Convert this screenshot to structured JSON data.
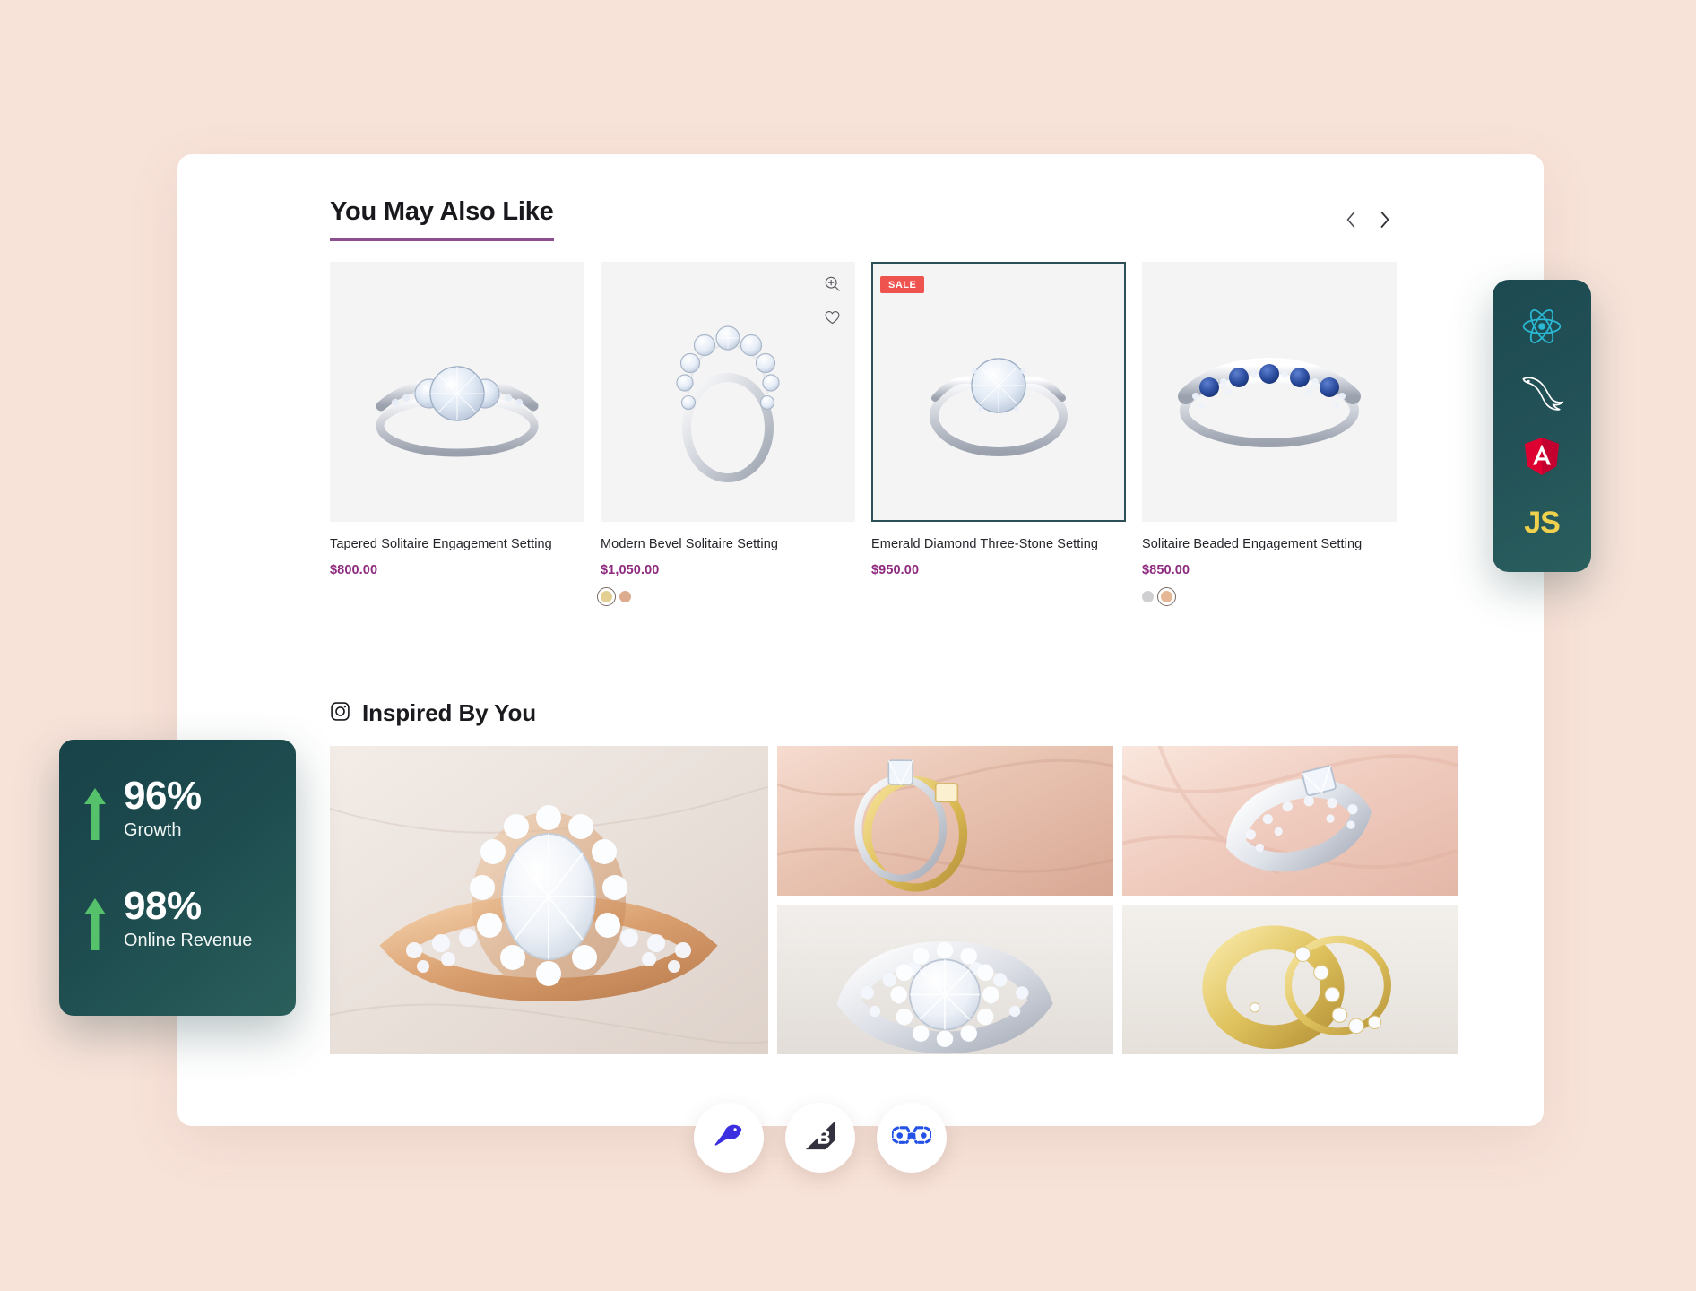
{
  "theme": {
    "page_background": "#f8e3d9",
    "panel_background": "#ffffff",
    "accent_underline": "#8e4f91",
    "price_color": "#8e2b7f",
    "sale_badge_color": "#ef5350",
    "selected_card_border": "#2c4f58",
    "stats_card_gradient_from": "#184349",
    "stats_card_gradient_to": "#2a5f5c",
    "arrow_green": "#55c16a",
    "js_yellow": "#f0d14e",
    "angular_red": "#dd0031",
    "react_cyan": "#2bb8d4"
  },
  "recommendations": {
    "title": "You May Also Like",
    "nav": {
      "prev_icon": "chevron-left-icon",
      "prev_label": "Previous",
      "next_icon": "chevron-right-icon",
      "next_label": "Next"
    },
    "products": [
      {
        "name": "Tapered Solitaire Engagement Setting",
        "price": "$800.00",
        "badge": "",
        "selected": false,
        "show_tools": false,
        "swatches": []
      },
      {
        "name": "Modern Bevel Solitaire Setting",
        "price": "$1,050.00",
        "badge": "",
        "selected": false,
        "show_tools": true,
        "tools": [
          {
            "icon": "zoom-in-icon",
            "label": "Quick view"
          },
          {
            "icon": "heart-icon",
            "label": "Add to wishlist"
          }
        ],
        "swatches": [
          {
            "name": "yellow-gold",
            "color": "#e3cf92",
            "active": true
          },
          {
            "name": "rose-gold",
            "color": "#ddab8e",
            "active": false
          }
        ]
      },
      {
        "name": "Emerald Diamond Three-Stone Setting",
        "price": "$950.00",
        "badge": "SALE",
        "selected": true,
        "show_tools": false,
        "swatches": []
      },
      {
        "name": "Solitaire Beaded Engagement Setting",
        "price": "$850.00",
        "badge": "",
        "selected": false,
        "show_tools": false,
        "swatches": [
          {
            "name": "silver",
            "color": "#cfcfd2",
            "active": false
          },
          {
            "name": "rose-gold",
            "color": "#e5b795",
            "active": true
          }
        ]
      }
    ]
  },
  "inspired": {
    "icon": "instagram-icon",
    "title": "Inspired By You",
    "photos": [
      {
        "alt": "Rose gold oval halo engagement ring on cream fabric",
        "slot": "main"
      },
      {
        "alt": "Two-tone gold and white gold rings held in fingers",
        "slot": "a"
      },
      {
        "alt": "Pave diamond band nestled in blush silk",
        "slot": "b"
      },
      {
        "alt": "White gold round halo diamond ring",
        "slot": "c"
      },
      {
        "alt": "Yellow gold wedding band with diamond accent ring",
        "slot": "d"
      }
    ]
  },
  "stats": {
    "items": [
      {
        "value": "96%",
        "label": "Growth",
        "trend_icon": "arrow-up-icon"
      },
      {
        "value": "98%",
        "label": "Online Revenue",
        "trend_icon": "arrow-up-icon"
      }
    ]
  },
  "tech_stack": {
    "items": [
      {
        "name": "React",
        "icon": "react-icon"
      },
      {
        "name": "MySQL",
        "icon": "mysql-dolphin-icon"
      },
      {
        "name": "Angular",
        "icon": "angular-icon"
      },
      {
        "name": "JavaScript",
        "icon": "javascript-icon",
        "mark": "JS"
      }
    ]
  },
  "platforms": {
    "items": [
      {
        "name": "Swell",
        "icon": "bird-icon"
      },
      {
        "name": "BigCommerce",
        "icon": "bigcommerce-icon"
      },
      {
        "name": "Chain Link",
        "icon": "chain-link-icon"
      }
    ]
  }
}
